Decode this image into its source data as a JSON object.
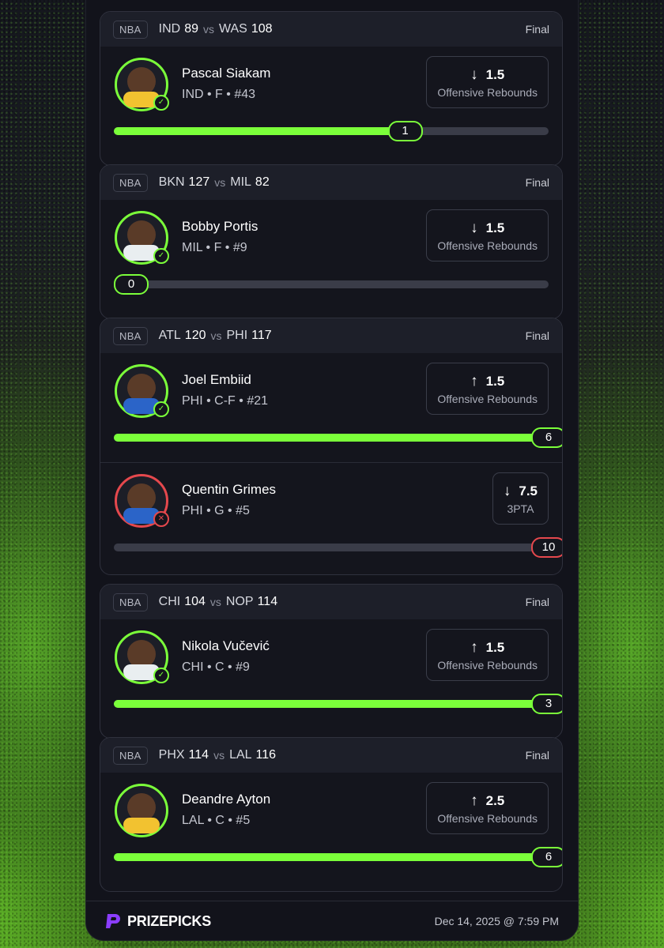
{
  "colors": {
    "win": "#7bff3a",
    "loss": "#e5484d",
    "brand": "#8b3dff"
  },
  "cards": [
    {
      "league": "NBA",
      "team1": "IND",
      "score1": "89",
      "vs": "vs",
      "team2": "WAS",
      "score2": "108",
      "status": "Final",
      "players": [
        {
          "name": "Pascal Siakam",
          "info": "IND • F • #43",
          "direction": "↓",
          "line": "1.5",
          "stat": "Offensive Rebounds",
          "actual": "1",
          "progress": 0.67,
          "result": "win",
          "result_icon": "check-icon",
          "jersey": "#f2c230"
        }
      ]
    },
    {
      "league": "NBA",
      "team1": "BKN",
      "score1": "127",
      "vs": "vs",
      "team2": "MIL",
      "score2": "82",
      "status": "Final",
      "players": [
        {
          "name": "Bobby Portis",
          "info": "MIL • F • #9",
          "direction": "↓",
          "line": "1.5",
          "stat": "Offensive Rebounds",
          "actual": "0",
          "progress": 0.0,
          "result": "win",
          "result_icon": "check-icon",
          "jersey": "#e9eef0"
        }
      ]
    },
    {
      "league": "NBA",
      "team1": "ATL",
      "score1": "120",
      "vs": "vs",
      "team2": "PHI",
      "score2": "117",
      "status": "Final",
      "players": [
        {
          "name": "Joel Embiid",
          "info": "PHI • C-F • #21",
          "direction": "↑",
          "line": "1.5",
          "stat": "Offensive Rebounds",
          "actual": "6",
          "progress": 1.0,
          "result": "win",
          "result_icon": "check-icon",
          "jersey": "#2b64c8"
        },
        {
          "name": "Quentin Grimes",
          "info": "PHI • G • #5",
          "direction": "↓",
          "line": "7.5",
          "stat": "3PTA",
          "actual": "10",
          "progress": 1.0,
          "result": "loss",
          "result_icon": "x-icon",
          "jersey": "#2b64c8"
        }
      ]
    },
    {
      "league": "NBA",
      "team1": "CHI",
      "score1": "104",
      "vs": "vs",
      "team2": "NOP",
      "score2": "114",
      "status": "Final",
      "players": [
        {
          "name": "Nikola Vučević",
          "info": "CHI • C • #9",
          "direction": "↑",
          "line": "1.5",
          "stat": "Offensive Rebounds",
          "actual": "3",
          "progress": 1.0,
          "result": "win",
          "result_icon": "check-icon",
          "jersey": "#e9eef0"
        }
      ]
    },
    {
      "league": "NBA",
      "team1": "PHX",
      "score1": "114",
      "vs": "vs",
      "team2": "LAL",
      "score2": "116",
      "status": "Final",
      "players": [
        {
          "name": "Deandre Ayton",
          "info": "LAL • C • #5",
          "direction": "↑",
          "line": "2.5",
          "stat": "Offensive Rebounds",
          "actual": "6",
          "progress": 1.0,
          "result": "win",
          "result_icon": "none",
          "jersey": "#f2c230"
        }
      ]
    }
  ],
  "footer": {
    "brand": "PRIZEPICKS",
    "date": "Dec 14, 2025 @ 7:59 PM"
  }
}
